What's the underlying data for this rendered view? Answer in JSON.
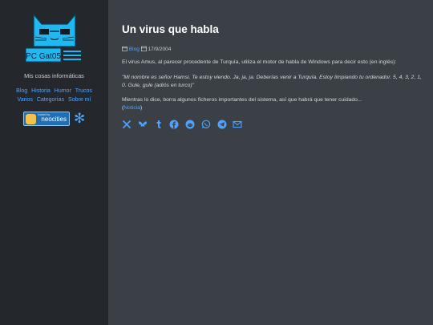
{
  "site": {
    "logo_text": "PC Gat05",
    "tagline": "Mis cosas informáticas",
    "nav": [
      "Blog",
      "Historia",
      "Humor",
      "Trucos",
      "Varios",
      "Categorías",
      "Sobre mí"
    ],
    "badge_text": "neocities",
    "badge_small": "hosted by"
  },
  "post": {
    "title": "Un virus que habla",
    "category": "Blog",
    "date": "17/9/2004",
    "intro": "El virus Amus, al parecer procedente de Turquía, utiliza el motor de habla de Windows para decir esto (en inglés):",
    "quote": "\"Mi nombre es señor Hamsi. Te estoy viendo. Ja, ja, ja. Deberías venir a Turquía. Estoy limpiando tu ordenador. 5, 4, 3, 2, 1, 0. Gule, gule (adiós en turco)\"",
    "outro": "Mientras lo dice, borra algunos ficheros importantes del sistema, así que habrá que tener cuidado...",
    "source_open": "(",
    "source_link": "Noticia",
    "source_close": ")"
  },
  "share_icons": [
    "x-icon",
    "bluesky-icon",
    "tumblr-icon",
    "facebook-icon",
    "reddit-icon",
    "whatsapp-icon",
    "telegram-icon",
    "email-icon"
  ],
  "colors": {
    "accent": "#4da3ff",
    "sidebar": "#24282d",
    "main": "#3b4046",
    "logo": "#1fb8f0"
  }
}
